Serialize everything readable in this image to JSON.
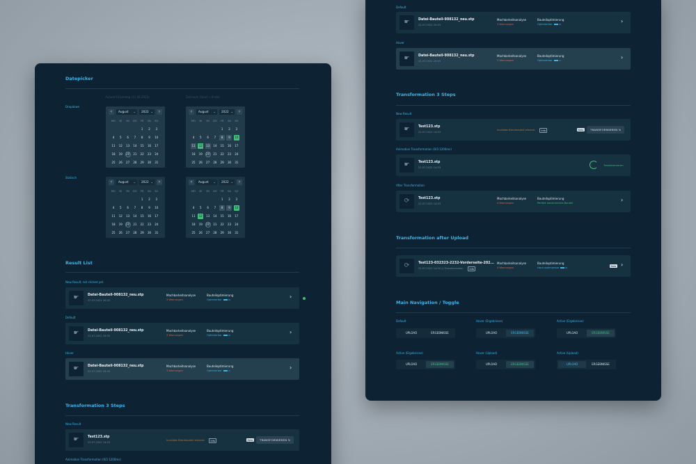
{
  "left": {
    "datepicker": {
      "title": "Datepicker",
      "hint_left": "Auswahl Einzeltag (11.08.2022)",
      "hint_right": "Zeitraum (Start → Ende)",
      "label_pressed": "Dropdown",
      "label_static": "Statisch",
      "month": "August",
      "year": "2022",
      "weekdays": [
        "MO",
        "DI",
        "MI",
        "DO",
        "FR",
        "SA",
        "SO"
      ]
    },
    "result_list": {
      "title": "Result List",
      "states": [
        "New Result, not clicked yet",
        "Default",
        "Hover"
      ]
    },
    "transformation": {
      "title": "Transformation 3 Steps",
      "state_new": "New Result",
      "state_anim": "Animation Transformation (0/3 1200ms)"
    }
  },
  "right": {
    "result_states": [
      "Default",
      "Hover"
    ],
    "transformation": {
      "title": "Transformation 3 Steps",
      "state_new": "New Result",
      "state_anim": "Animation Transformation (0/3 1200ms)",
      "state_after": "After Transformation",
      "transforming_label": "Transformieren",
      "after_analysis_sub": "4 Warnungen",
      "after_opt_sub": "Perfekt konstruiertes Bauteil"
    },
    "upload": {
      "title": "Transformation after Upload",
      "filename": "Test123-032323-2232-Vorderseite-202...",
      "date": "22.07.2022 14:50",
      "transforming": "Transformation",
      "analysis_sub": "4 Warnungen",
      "opt_sub": "Hoch optimierbar"
    },
    "nav": {
      "title": "Main Navigation / Toggle",
      "upload": "UPLOAD",
      "results": "ERGEBNISSE",
      "states": [
        "Default",
        "Hover (Ergebnisse)",
        "Active (Ergebnisse)",
        "Active (Ergebnisse)",
        "Hover (Upload)",
        "Active (Upload)"
      ]
    }
  },
  "file": {
    "name": "Datei-Bauteil-908132_neu.stp",
    "date": "22.07.2022 20:03",
    "analysis": "Machbarkeitsanalyse",
    "warnings": "3 Warnungen",
    "optimization": "Bauteiloptimierung",
    "optimizable": "Optimierbar"
  },
  "test": {
    "name": "Test123.stp",
    "date": "22.07.2022 14:53",
    "invalid": "Invalides Blechbauteil erkannt",
    "info": "Info",
    "beta": "Beta",
    "button": "TRANSFORMIEREN"
  },
  "colors": {
    "panel": "#0d2232",
    "accent_blue": "#3fb6e8",
    "accent_green": "#3fbf77",
    "warning": "#d46a4a"
  }
}
